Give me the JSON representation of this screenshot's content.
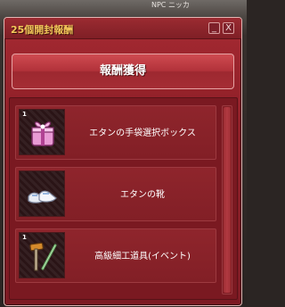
{
  "world": {
    "overhead_label": "NPC ニッカ"
  },
  "window": {
    "title": "25個開封報酬",
    "minimize_label": "_",
    "close_label": "X"
  },
  "claim_button": {
    "label": "報酬獲得"
  },
  "rewards": [
    {
      "qty": "1",
      "name": "エタンの手袋選択ボックス",
      "icon": "gift-box-icon"
    },
    {
      "qty": "",
      "name": "エタンの靴",
      "icon": "shoes-icon"
    },
    {
      "qty": "1",
      "name": "高級細工道具(イベント)",
      "icon": "hammer-tool-icon"
    }
  ],
  "colors": {
    "window_bg": "#8e1e27",
    "title_text": "#f3c85a",
    "button_bg": "#b2323a"
  }
}
